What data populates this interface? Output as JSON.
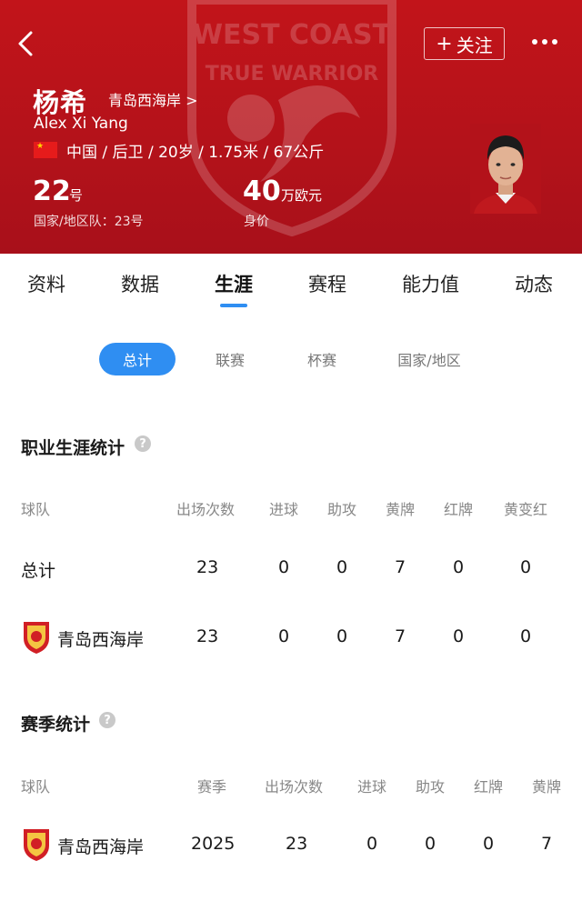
{
  "header": {
    "bg_color": "#c2141a",
    "follow_label": "关注",
    "player_name": "杨希",
    "team_link": "青岛西海岸 >",
    "english_name": "Alex Xi Yang",
    "info": "中国 / 后卫 / 20岁 / 1.75米 / 67公斤",
    "shirt_number": "22",
    "shirt_unit": "号",
    "national_number": "国家/地区队：23号",
    "value": "40",
    "value_unit": "万欧元",
    "value_label": "身价",
    "crest_text_top": "WEST COAST",
    "crest_text_bottom": "TRUE WARRIOR"
  },
  "tabs": [
    {
      "label": "资料"
    },
    {
      "label": "数据"
    },
    {
      "label": "生涯",
      "active": true
    },
    {
      "label": "赛程"
    },
    {
      "label": "能力值"
    },
    {
      "label": "动态"
    }
  ],
  "filters": [
    {
      "label": "总计",
      "active": true
    },
    {
      "label": "联赛"
    },
    {
      "label": "杯赛"
    },
    {
      "label": "国家/地区"
    }
  ],
  "career": {
    "title": "职业生涯统计",
    "columns": [
      "球队",
      "出场次数",
      "进球",
      "助攻",
      "黄牌",
      "红牌",
      "黄变红"
    ],
    "rows": [
      {
        "team": "总计",
        "apps": "23",
        "goals": "0",
        "assists": "0",
        "yellow": "7",
        "red": "0",
        "yellow_red": "0"
      },
      {
        "team": "青岛西海岸",
        "apps": "23",
        "goals": "0",
        "assists": "0",
        "yellow": "7",
        "red": "0",
        "yellow_red": "0"
      }
    ]
  },
  "season": {
    "title": "赛季统计",
    "columns": [
      "球队",
      "赛季",
      "出场次数",
      "进球",
      "助攻",
      "红牌",
      "黄牌"
    ],
    "rows": [
      {
        "team": "青岛西海岸",
        "season": "2025",
        "apps": "23",
        "goals": "0",
        "assists": "0",
        "red": "0",
        "yellow": "7"
      }
    ]
  },
  "accent_color": "#2f8ef2"
}
